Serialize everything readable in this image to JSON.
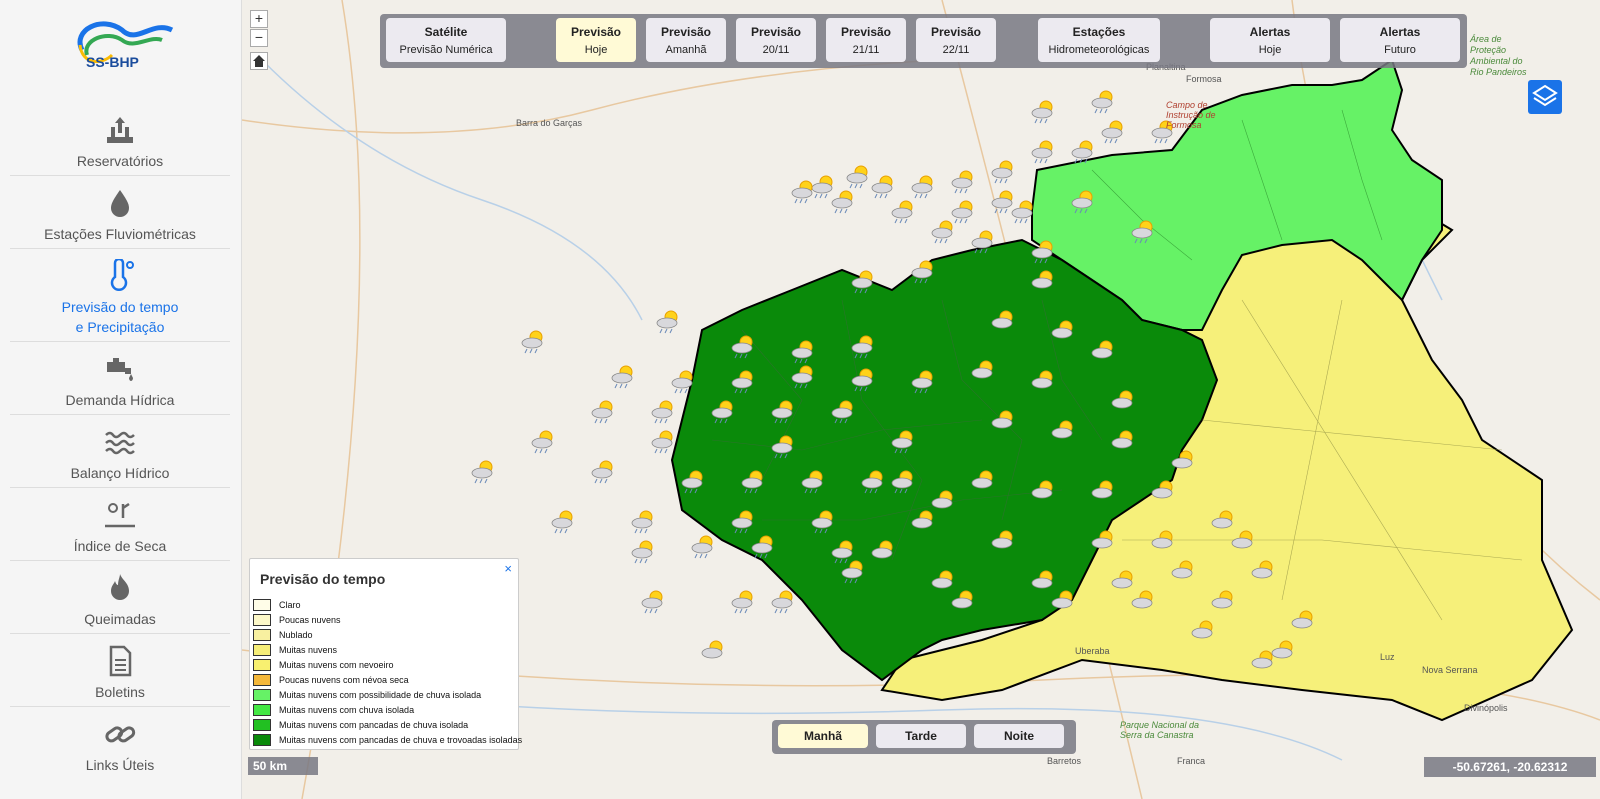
{
  "sidebar": {
    "logo_text": "SS-BHP",
    "items": [
      {
        "label_line1": "Reservatórios",
        "label_line2": "",
        "icon": "reservoir-icon",
        "active": false
      },
      {
        "label_line1": "Estações Fluviométricas",
        "label_line2": "",
        "icon": "water-drop-icon",
        "active": false
      },
      {
        "label_line1": "Previsão do tempo",
        "label_line2": "e Precipitação",
        "icon": "thermometer-icon",
        "active": true
      },
      {
        "label_line1": "Demanda Hídrica",
        "label_line2": "",
        "icon": "faucet-icon",
        "active": false
      },
      {
        "label_line1": "Balanço Hídrico",
        "label_line2": "",
        "icon": "waves-icon",
        "active": false
      },
      {
        "label_line1": "Índice de Seca",
        "label_line2": "",
        "icon": "drought-icon",
        "active": false
      },
      {
        "label_line1": "Queimadas",
        "label_line2": "",
        "icon": "fire-icon",
        "active": false
      },
      {
        "label_line1": "Boletins",
        "label_line2": "",
        "icon": "document-icon",
        "active": false
      },
      {
        "label_line1": "Links Úteis",
        "label_line2": "",
        "icon": "link-icon",
        "active": false
      }
    ]
  },
  "zoom": {
    "plus": "+",
    "minus": "−"
  },
  "toolbar": {
    "buttons": [
      {
        "title": "Satélite",
        "sub": "Previsão Numérica",
        "active": false
      },
      {
        "title": "Previsão",
        "sub": "Hoje",
        "active": true
      },
      {
        "title": "Previsão",
        "sub": "Amanhã",
        "active": false
      },
      {
        "title": "Previsão",
        "sub": "20/11",
        "active": false
      },
      {
        "title": "Previsão",
        "sub": "21/11",
        "active": false
      },
      {
        "title": "Previsão",
        "sub": "22/11",
        "active": false
      },
      {
        "title": "Estações",
        "sub": "Hidrometeorológicas",
        "active": false
      },
      {
        "title": "Alertas",
        "sub": "Hoje",
        "active": false
      },
      {
        "title": "Alertas",
        "sub": "Futuro",
        "active": false
      }
    ]
  },
  "legend": {
    "title": "Previsão do tempo",
    "close": "×",
    "items": [
      {
        "label": "Claro",
        "color": "#fffde8"
      },
      {
        "label": "Poucas nuvens",
        "color": "#fdf8c8"
      },
      {
        "label": "Nublado",
        "color": "#f8f0a0"
      },
      {
        "label": "Muitas nuvens",
        "color": "#f6ee78"
      },
      {
        "label": "Muitas nuvens com nevoeiro",
        "color": "#f8f070"
      },
      {
        "label": "Poucas nuvens com névoa seca",
        "color": "#f5b83a"
      },
      {
        "label": "Muitas nuvens com possibilidade de chuva isolada",
        "color": "#66f266"
      },
      {
        "label": "Muitas nuvens com chuva isolada",
        "color": "#44e844"
      },
      {
        "label": "Muitas nuvens com pancadas de chuva isolada",
        "color": "#22c022"
      },
      {
        "label": "Muitas nuvens com pancadas de chuva e trovoadas isoladas",
        "color": "#0a8a0a"
      }
    ]
  },
  "bottom_toolbar": {
    "buttons": [
      {
        "label": "Manhã",
        "active": true
      },
      {
        "label": "Tarde",
        "active": false
      },
      {
        "label": "Noite",
        "active": false
      }
    ]
  },
  "scale": "50 km",
  "coordinates": "-50.67261, -20.62312",
  "places": [
    {
      "name": "Barra do Garças",
      "style": "normal"
    },
    {
      "name": "Formosa",
      "style": "normal"
    },
    {
      "name": "Planaltina",
      "style": "normal"
    },
    {
      "name": "Uberaba",
      "style": "normal"
    },
    {
      "name": "Barretos",
      "style": "normal"
    },
    {
      "name": "Franca",
      "style": "normal"
    },
    {
      "name": "Luz",
      "style": "normal"
    },
    {
      "name": "Nova Serrana",
      "style": "normal"
    },
    {
      "name": "Divinópolis",
      "style": "normal"
    },
    {
      "name": "Área de Proteção Ambiental do Rio Pandeiros",
      "style": "green"
    },
    {
      "name": "Campo de Instrução de Formosa",
      "style": "red"
    },
    {
      "name": "Parque Nacional da Serra da Canastra",
      "style": "green"
    }
  ],
  "colors": {
    "accent": "#1a73e8",
    "dark_green": "#0a8a0a",
    "light_green": "#66f266",
    "yellow": "#f6f07a"
  }
}
